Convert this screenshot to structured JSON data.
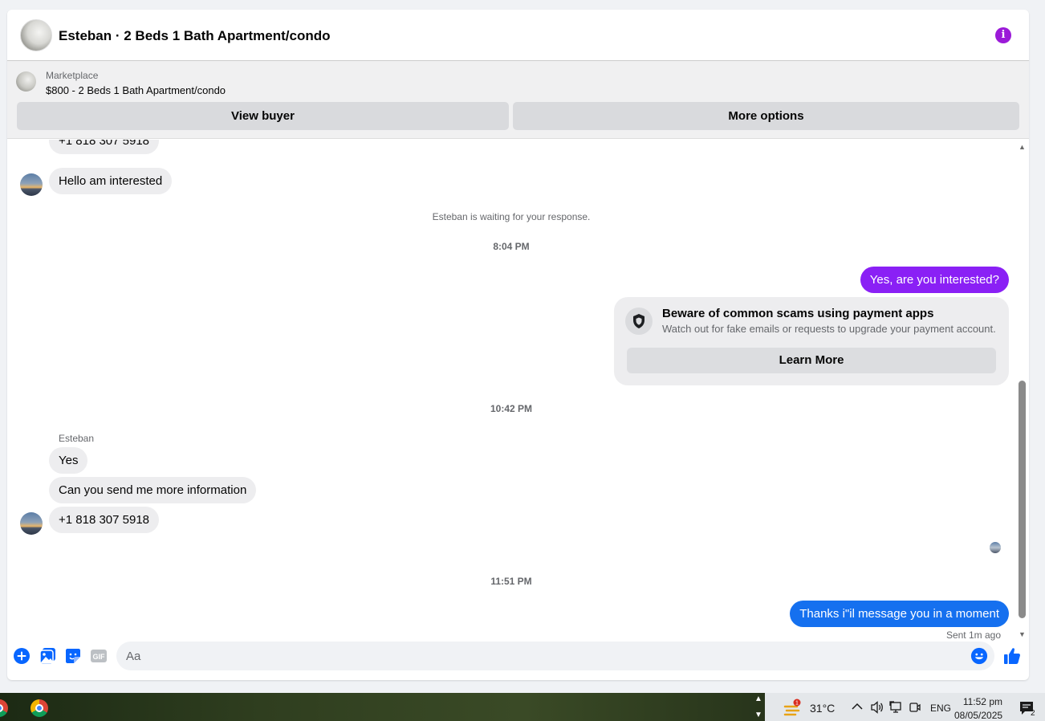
{
  "header": {
    "title": "Esteban · 2 Beds 1 Bath Apartment/condo"
  },
  "marketplace": {
    "label": "Marketplace",
    "listing": "$800 - 2 Beds 1 Bath Apartment/condo",
    "view_buyer": "View buyer",
    "more_options": "More options"
  },
  "thread": {
    "msg_phone_top": "+1 818 307 5918",
    "msg_interested": "Hello am interested",
    "waiting_notice": "Esteban is waiting for your response.",
    "time_1": "8:04 PM",
    "msg_out_1": "Yes, are you interested?",
    "scam": {
      "title": "Beware of common scams using payment apps",
      "subtitle": "Watch out for fake emails or requests to upgrade your payment account.",
      "learn_more": "Learn More"
    },
    "time_2": "10:42 PM",
    "sender_name": "Esteban",
    "msg_yes": "Yes",
    "msg_info": "Can you send me more information",
    "msg_phone": "+1 818 307 5918",
    "time_3": "11:51 PM",
    "msg_out_2": "Thanks i\"il message you in a moment",
    "sent_status": "Sent 1m ago"
  },
  "composer": {
    "placeholder": "Aa"
  },
  "taskbar": {
    "weather": "31°C",
    "weather_badge": "1",
    "language": "ENG",
    "time": "11:52 pm",
    "date": "08/05/2025",
    "notification_count": "2"
  },
  "colors": {
    "accent_purple": "#8a20f5",
    "accent_blue": "#1570ef",
    "info_icon": "#9b1ad8",
    "icon_blue": "#0866ff"
  }
}
